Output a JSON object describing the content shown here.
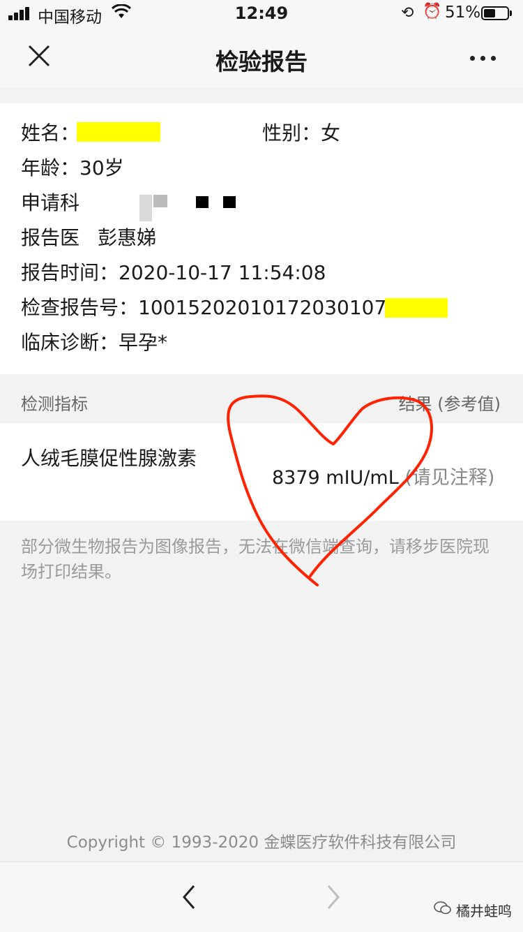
{
  "status_bar": {
    "carrier": "中国移动",
    "time": "12:49",
    "battery": "51%",
    "battery_level": 0.51
  },
  "nav": {
    "title": "检验报告"
  },
  "patient": {
    "name_label": "姓名：",
    "gender_label": "性别：",
    "gender_value": "女",
    "age_label": "年龄：",
    "age_value": "30岁",
    "dept_label": "申请科",
    "doctor_label": "报告医",
    "doctor_value": "彭惠娣",
    "time_label": "报告时间：",
    "time_value": "2020-10-17 11:54:08",
    "report_no_label": "检查报告号：",
    "report_no_value": "100152020101720301075",
    "diagnosis_label": "临床诊断：",
    "diagnosis_value": "早孕*"
  },
  "table": {
    "header_item": "检测指标",
    "header_result": "结果 (参考值)",
    "rows": [
      {
        "name": "人绒毛膜促性腺激素",
        "value": "8379 mIU/mL",
        "reference": "(请见注释)"
      }
    ]
  },
  "note": "部分微生物报告为图像报告，无法在微信端查询，请移步医院现场打印结果。",
  "copyright": "Copyright © 1993-2020 金蝶医疗软件科技有限公司",
  "watermark": "橘井蛙鸣",
  "colors": {
    "highlight_mask": "#ffff00",
    "annotation_heart": "#ff2200"
  }
}
